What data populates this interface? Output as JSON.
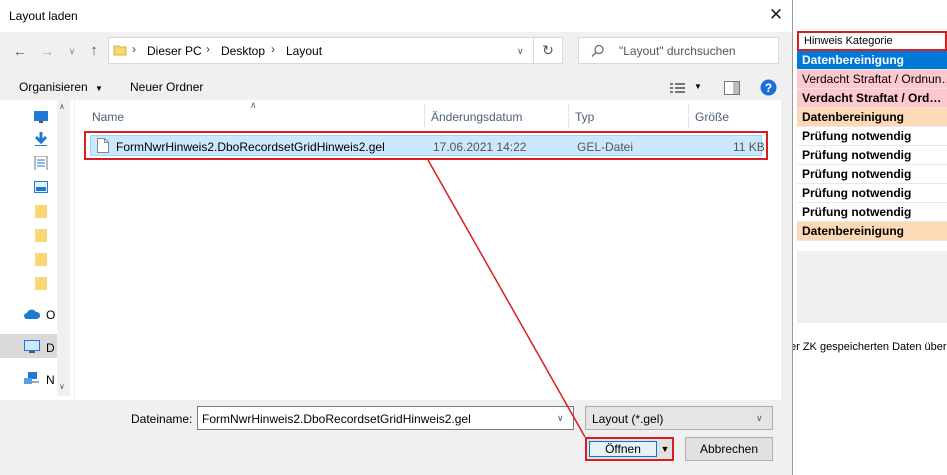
{
  "dialog": {
    "title": "Layout laden",
    "close_glyph": "✕",
    "breadcrumb": [
      "Dieser PC",
      "Desktop",
      "Layout"
    ],
    "search_placeholder": "\"Layout\" durchsuchen",
    "toolbar": {
      "organize": "Organisieren",
      "new_folder": "Neuer Ordner"
    },
    "columns": {
      "name": "Name",
      "modified": "Änderungsdatum",
      "type": "Typ",
      "size": "Größe"
    },
    "files": [
      {
        "name": "FormNwrHinweis2.DboRecordsetGridHinweis2.gel",
        "modified": "17.06.2021 14:22",
        "type": "GEL-Datei",
        "size": "11 KB"
      }
    ],
    "nav_labels": [
      "O",
      "D",
      "N"
    ],
    "filename_label": "Dateiname:",
    "filename_value": "FormNwrHinweis2.DboRecordsetGridHinweis2.gel",
    "filter_value": "Layout (*.gel)",
    "open_label": "Öffnen",
    "cancel_label": "Abbrechen"
  },
  "background_app": {
    "header": "Hinweis Kategorie",
    "rows": [
      {
        "label": "Datenbereinigung",
        "style": "selected"
      },
      {
        "label": "Verdacht Straftat / Ordnun…",
        "style": "pink"
      },
      {
        "label": "Verdacht Straftat / Ord…",
        "style": "pink-bold"
      },
      {
        "label": "Datenbereinigung",
        "style": "peach"
      },
      {
        "label": "Prüfung notwendig",
        "style": "white"
      },
      {
        "label": "Prüfung notwendig",
        "style": "white"
      },
      {
        "label": "Prüfung notwendig",
        "style": "white"
      },
      {
        "label": "Prüfung notwendig",
        "style": "white"
      },
      {
        "label": "Prüfung notwendig",
        "style": "white"
      },
      {
        "label": "Datenbereinigung",
        "style": "peach"
      }
    ],
    "footer_text": "er ZK gespeicherten Daten übere"
  },
  "colors": {
    "highlight_red": "#d81e1e",
    "selection_blue": "#0078d7",
    "row_pink": "#ffc7ce",
    "row_peach": "#fdd9b5"
  }
}
